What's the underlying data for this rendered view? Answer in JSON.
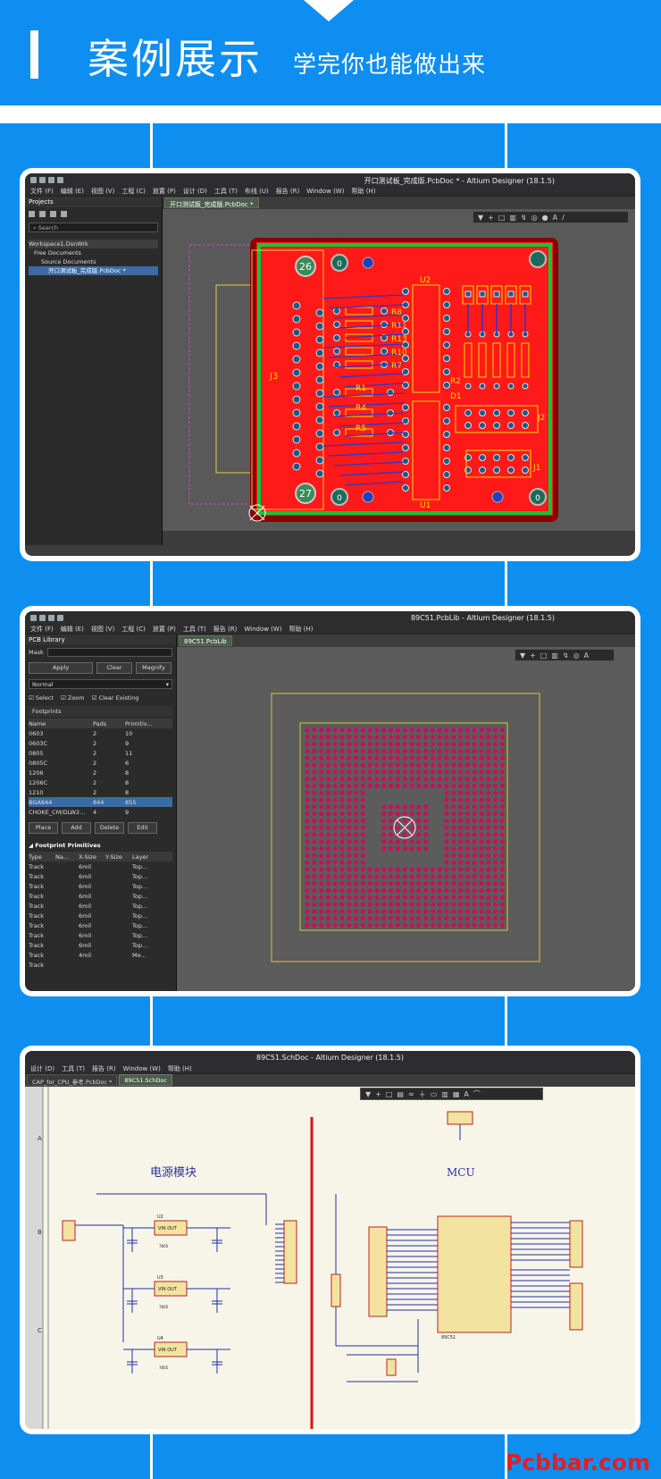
{
  "header": {
    "title": "案例展示",
    "subtitle": "学完你也能做出来"
  },
  "brand": "Pcbbar.com",
  "w1": {
    "title": "开口测试板_完成版.PcbDoc * - Altium Designer (18.1.5)",
    "menus": [
      "文件 (F)",
      "编辑 (E)",
      "视图 (V)",
      "工程 (C)",
      "放置 (P)",
      "设计 (D)",
      "工具 (T)",
      "布线 (U)",
      "报告 (R)",
      "Window (W)",
      "帮助 (H)"
    ],
    "panel_title": "Projects",
    "search": "Search",
    "tree": [
      "Workspace1.DsnWrk",
      "Free Documents",
      "Source Documents",
      "开口测试板_完成版.PcbDoc *"
    ],
    "tab": "开口测试板_完成版.PcbDoc *",
    "labels": {
      "j3": "J3",
      "u2": "U2",
      "u1": "U1",
      "j2": "J2",
      "j1": "J1",
      "r8": "R8",
      "r11": "R11",
      "r13": "R13",
      "r10": "R10",
      "r7": "R7",
      "r1": "R1",
      "r4": "R4",
      "r5": "R5",
      "r2": "R2",
      "d1": "D1",
      "n26": "26",
      "n27": "27",
      "n0": "0"
    }
  },
  "w2": {
    "title": "89C51.PcbLib - Altium Designer (18.1.5)",
    "menus": [
      "文件 (F)",
      "编辑 (E)",
      "视图 (V)",
      "工程 (C)",
      "放置 (P)",
      "工具 (T)",
      "报告 (R)",
      "Window (W)",
      "帮助 (H)"
    ],
    "panel_title": "PCB Library",
    "mask": "Mask",
    "apply": "Apply",
    "clear": "Clear",
    "magnify": "Magnify",
    "normal": "Normal",
    "select": "Select",
    "zoom": "Zoom",
    "clear_existing": "Clear Existing",
    "footprints": "Footprints",
    "fp_cols": [
      "Name",
      "Pads",
      "Primitiv..."
    ],
    "fp_rows": [
      [
        "0603",
        "2",
        "10"
      ],
      [
        "0603C",
        "2",
        "9"
      ],
      [
        "0805",
        "2",
        "11"
      ],
      [
        "0805C",
        "2",
        "6"
      ],
      [
        "1206",
        "2",
        "8"
      ],
      [
        "1206C",
        "2",
        "8"
      ],
      [
        "1210",
        "2",
        "8"
      ],
      [
        "BGA844",
        "844",
        "855"
      ],
      [
        "CHOKE_CM/DLW2...",
        "4",
        "9"
      ]
    ],
    "btns": [
      "Place",
      "Add",
      "Delete",
      "Edit"
    ],
    "prim_title": "Footprint Primitives",
    "prim_cols": [
      "Type",
      "Na...",
      "X-Size",
      "Y-Size",
      "Layer"
    ],
    "prim_rows": [
      [
        "Track",
        "",
        "6mil",
        "",
        "Top..."
      ],
      [
        "Track",
        "",
        "6mil",
        "",
        "Top..."
      ],
      [
        "Track",
        "",
        "6mil",
        "",
        "Top..."
      ],
      [
        "Track",
        "",
        "6mil",
        "",
        "Top..."
      ],
      [
        "Track",
        "",
        "6mil",
        "",
        "Top..."
      ],
      [
        "Track",
        "",
        "6mil",
        "",
        "Top..."
      ],
      [
        "Track",
        "",
        "6mil",
        "",
        "Top..."
      ],
      [
        "Track",
        "",
        "6mil",
        "",
        "Top..."
      ],
      [
        "Track",
        "",
        "6mil",
        "",
        "Top..."
      ],
      [
        "Track",
        "",
        "4mil",
        "",
        "Me..."
      ],
      [
        "Track",
        "",
        "",
        "",
        ""
      ]
    ],
    "tab": "89C51.PcbLib"
  },
  "w3": {
    "title": "89C51.SchDoc - Altium Designer (18.1.5)",
    "menus": [
      "设计 (D)",
      "工具 (T)",
      "报告 (R)",
      "Window (W)",
      "帮助 (H)"
    ],
    "tabs": [
      "CAP_for_CPU_参考.PcbDoc *",
      "89C51.SchDoc"
    ],
    "power": "电源模块",
    "mcu": "MCU",
    "rows": [
      "A",
      "B",
      "C"
    ],
    "u_labels": [
      "U2",
      "U3",
      "U4"
    ],
    "vinout": "VIN  OUT",
    "vreg": "7805",
    "chip": "89C51"
  }
}
